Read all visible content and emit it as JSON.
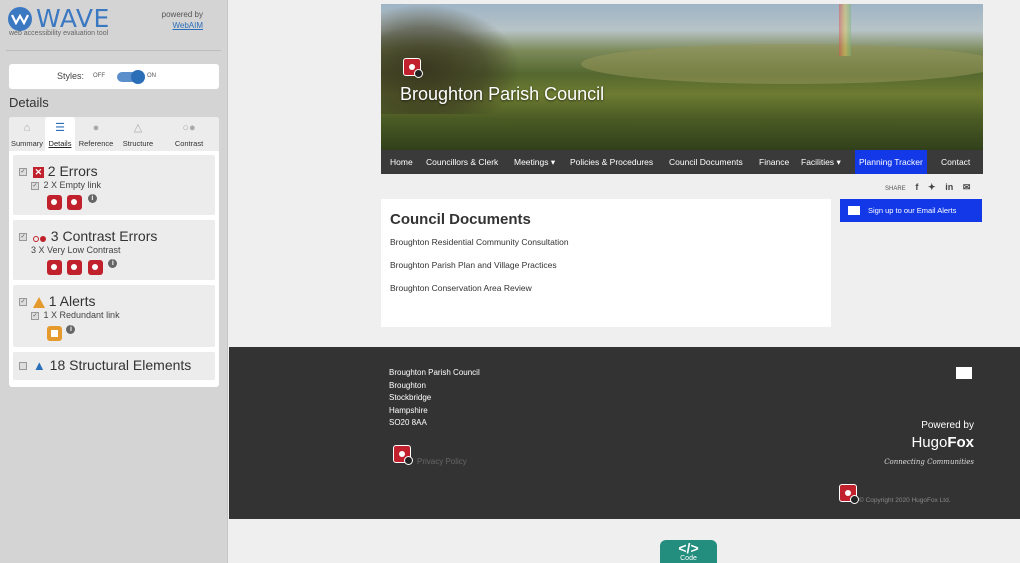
{
  "wave": {
    "title": "WAVE",
    "tagline": "web accessibility evaluation tool",
    "powered_by": "powered by",
    "webaim": "WebAIM",
    "styles_label": "Styles:",
    "styles_off": "OFF",
    "styles_on": "ON",
    "details_heading": "Details",
    "tabs": [
      {
        "label": "Summary",
        "icon": "home-icon"
      },
      {
        "label": "Details",
        "icon": "list-icon"
      },
      {
        "label": "Reference",
        "icon": "info-icon"
      },
      {
        "label": "Structure",
        "icon": "structure-icon"
      },
      {
        "label": "Contrast",
        "icon": "contrast-icon"
      }
    ],
    "groups": {
      "errors": {
        "title": "2 Errors",
        "item": "2 X Empty link"
      },
      "contrast": {
        "title": "3 Contrast Errors",
        "item": "3 X Very Low Contrast"
      },
      "alerts": {
        "title": "1 Alerts",
        "item": "1 X Redundant link"
      },
      "structure": {
        "title": "18 Structural Elements"
      }
    },
    "colors": {
      "accent": "#3b78c2",
      "error": "#c0212c",
      "alert": "#e49a2d"
    }
  },
  "site": {
    "hero_title": "Broughton Parish Council",
    "nav": {
      "home": "Home",
      "councillors": "Councillors & Clerk",
      "meetings": "Meetings",
      "policies": "Policies & Procedures",
      "documents": "Council Documents",
      "finance": "Finance",
      "facilities": "Facilities",
      "planning": "Planning Tracker",
      "contact": "Contact"
    },
    "share_label": "SHARE",
    "signup": "Sign up to our Email Alerts",
    "content": {
      "heading": "Council Documents",
      "links": [
        "Broughton Residential Community Consultation",
        "Broughton Parish Plan and Village Practices",
        "Broughton Conservation Area Review"
      ]
    },
    "footer": {
      "address": [
        "Broughton Parish Council",
        "Broughton",
        "Stockbridge",
        "Hampshire",
        "SO20 8AA"
      ],
      "privacy": "Privacy Policy",
      "powered_by": "Powered by",
      "hugo": "Hugo",
      "fox": "Fox",
      "connecting": "Connecting Communities",
      "copyright": "© Copyright 2020 HugoFox Ltd."
    },
    "code_button": "Code",
    "colors": {
      "nav_bg": "#3a3a3a",
      "highlight": "#1238e8",
      "footer_bg": "#333333",
      "code_btn": "#238e7e"
    }
  }
}
